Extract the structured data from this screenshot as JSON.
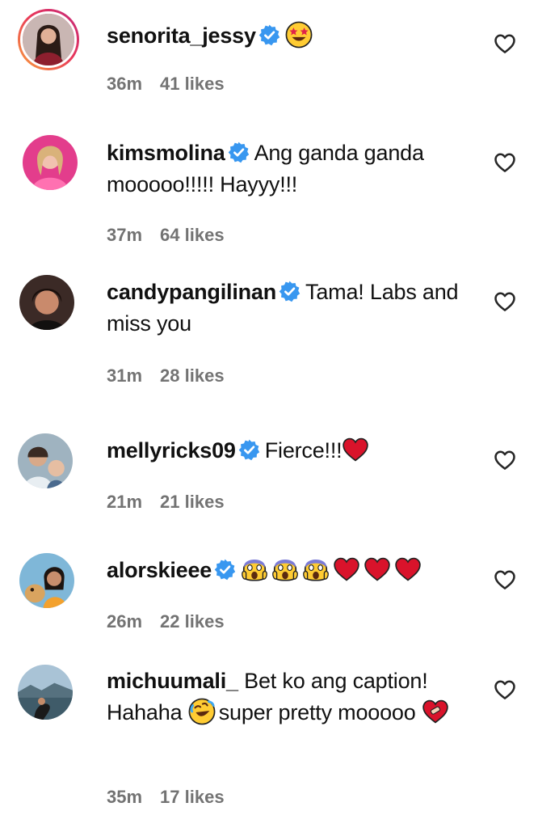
{
  "comments": [
    {
      "username": "senorita_jessy",
      "text": "",
      "time": "36m",
      "likes": "41 likes",
      "emojis": [
        "star-struck-emoji"
      ],
      "avatar": "avatar-woman-red-dress"
    },
    {
      "username": "kimsmolina",
      "text": "Ang ganda ganda mooooo!!!!! Hayyy!!!",
      "time": "37m",
      "likes": "64 likes",
      "avatar": "avatar-woman-pink"
    },
    {
      "username": "candypangilinan",
      "text": "Tama! Labs and miss you",
      "time": "31m",
      "likes": "28 likes",
      "avatar": "avatar-woman-dark"
    },
    {
      "username": "mellyricks09",
      "text": "Fierce!!!",
      "time": "21m",
      "likes": "21 likes",
      "emojis": [
        "red-heart-emoji"
      ],
      "avatar": "avatar-family"
    },
    {
      "username": "alorskieee",
      "text": "",
      "time": "26m",
      "likes": "22 likes",
      "emojis": [
        "screaming-face-emoji",
        "screaming-face-emoji",
        "screaming-face-emoji",
        "red-heart-emoji",
        "red-heart-emoji",
        "red-heart-emoji"
      ],
      "avatar": "avatar-woman-dog"
    },
    {
      "username": "michuumali_",
      "text_part1": "Bet ko ang caption! Hahaha",
      "text_part2": "super pretty mooooo",
      "time": "35m",
      "likes": "17 likes",
      "emojis": [
        "rolling-laughing-emoji",
        "mending-heart-emoji"
      ],
      "avatar": "avatar-lake"
    }
  ],
  "colors": {
    "verified": "#3897f0",
    "meta": "#737373",
    "heart": "#e0245e"
  }
}
